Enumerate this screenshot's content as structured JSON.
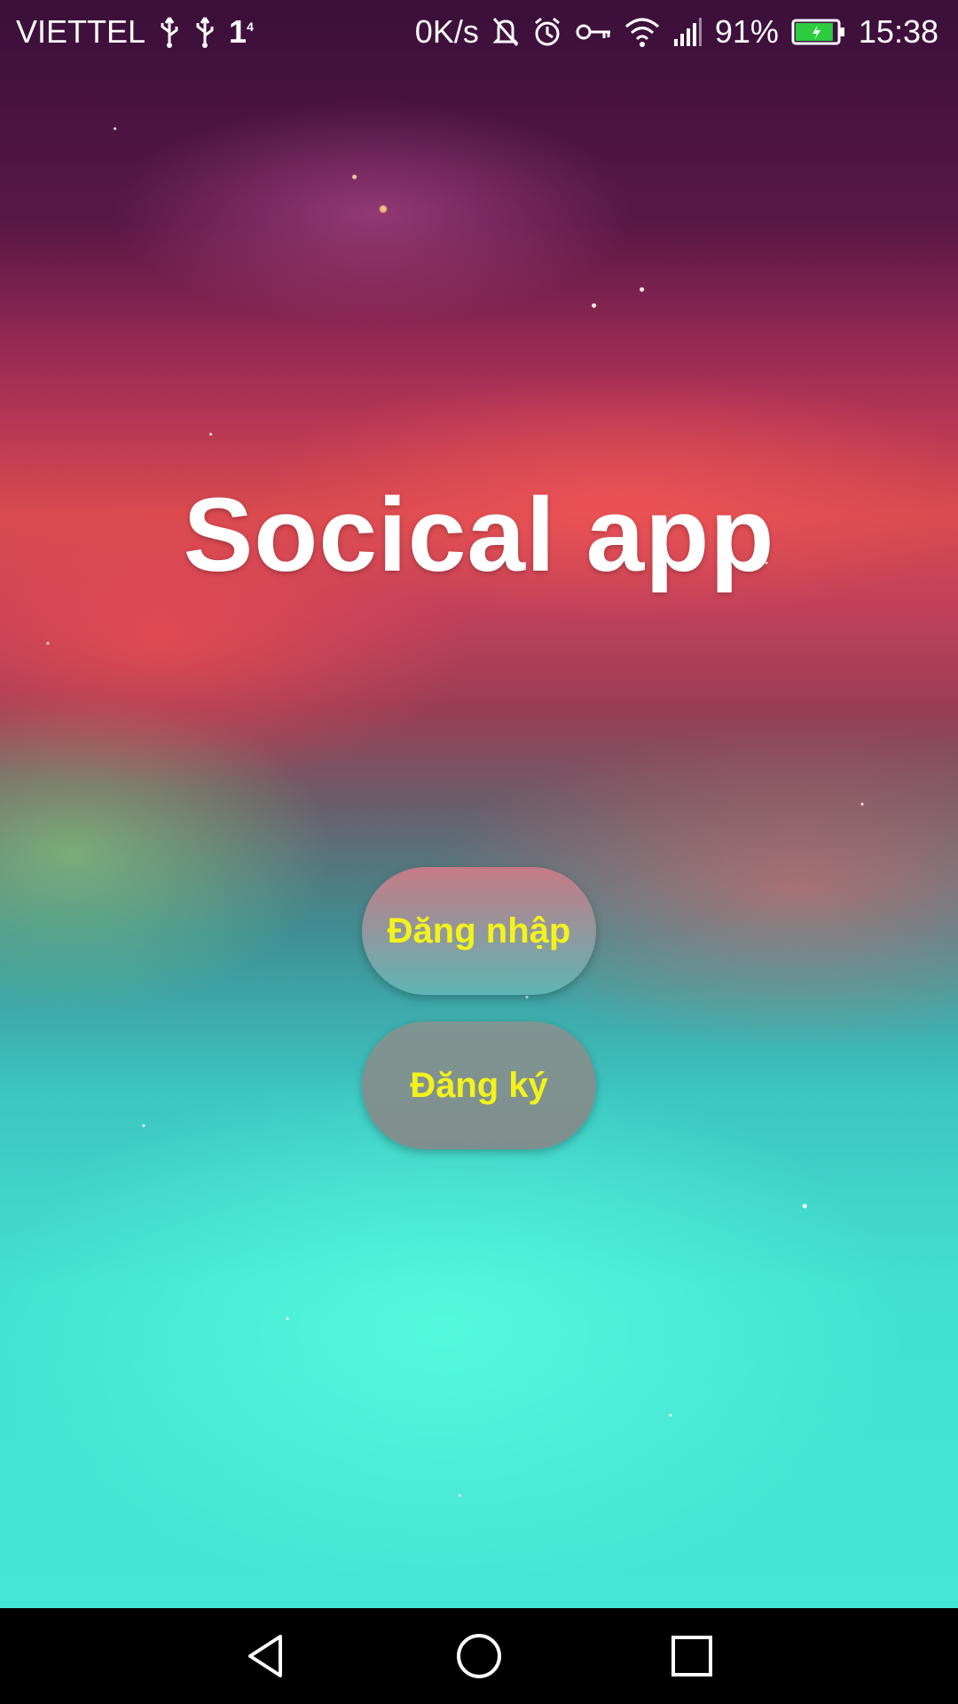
{
  "status_bar": {
    "carrier": "VIETTEL",
    "network_badge": "1",
    "network_badge_sup": "4",
    "speed": "0K/s",
    "battery_percent": "91%",
    "time": "15:38",
    "battery_level": 0.91,
    "battery_color": "#2ecc40"
  },
  "app": {
    "title": "Socical app"
  },
  "buttons": {
    "login_label": "Đăng nhập",
    "register_label": "Đăng ký",
    "label_color": "#f4f21c"
  },
  "nav": {
    "back": "back-icon",
    "home": "home-icon",
    "recents": "recents-icon"
  }
}
